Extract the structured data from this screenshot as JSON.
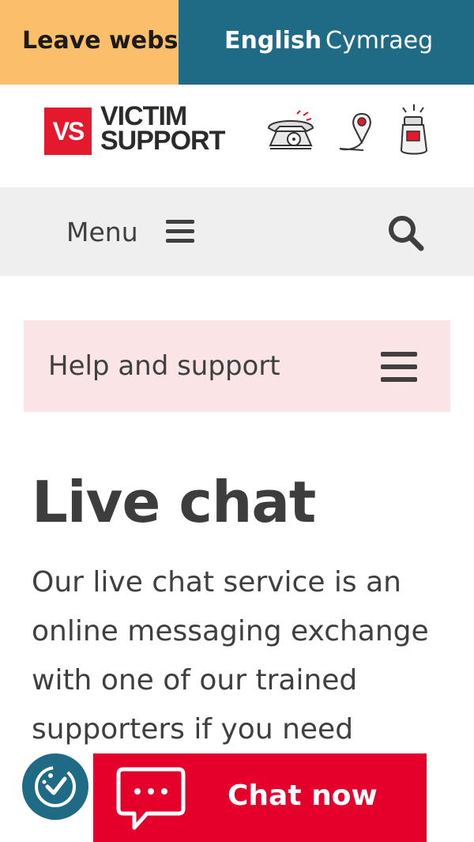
{
  "topbar": {
    "leave_label": "Leave websi",
    "languages": [
      {
        "label": "English"
      },
      {
        "label": "Cymraeg"
      }
    ]
  },
  "header": {
    "logo_mark": "VS",
    "logo_line1": "VICTIM",
    "logo_line2": "SUPPORT",
    "icons": [
      "phone-icon",
      "location-pin-icon",
      "alarm-icon"
    ]
  },
  "nav": {
    "menu_label": "Menu",
    "search_icon": "search-icon"
  },
  "section_nav": {
    "label": "Help and support"
  },
  "main": {
    "title": "Live chat",
    "intro": "Our live chat service is an online messaging exchange with one of our trained supporters if you need"
  },
  "floating": {
    "chat_label": "Chat now",
    "accessibility_icon": "accessibility-icon"
  },
  "colors": {
    "leave_bg": "#fbbf6c",
    "lang_bg": "#1f6b86",
    "brand_red": "#e4002b",
    "help_bg": "#fbe4e6",
    "menu_bg": "#efefef"
  }
}
